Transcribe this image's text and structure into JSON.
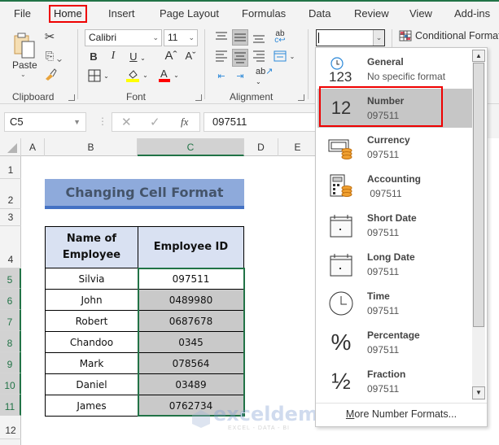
{
  "ribbon_tabs": [
    {
      "label": "File"
    },
    {
      "label": "Home",
      "active": true
    },
    {
      "label": "Insert"
    },
    {
      "label": "Page Layout"
    },
    {
      "label": "Formulas"
    },
    {
      "label": "Data"
    },
    {
      "label": "Review"
    },
    {
      "label": "View"
    },
    {
      "label": "Add-ins"
    }
  ],
  "ribbon": {
    "clipboard": {
      "label": "Clipboard",
      "paste_label": "Paste"
    },
    "font": {
      "label": "Font",
      "font_name": "Calibri",
      "font_size": "11",
      "fill_color": "#ffff00",
      "font_color": "#ff0000"
    },
    "alignment": {
      "label": "Alignment"
    },
    "number_format_value": "",
    "conditional_formatting_label": "Conditional Format"
  },
  "formula_bar": {
    "name_box": "C5",
    "fx_label": "fx",
    "value": "097511"
  },
  "columns": [
    "A",
    "B",
    "C",
    "D",
    "E"
  ],
  "selected_column": "C",
  "rows": [
    "1",
    "2",
    "3",
    "4",
    "5",
    "6",
    "7",
    "8",
    "9",
    "10",
    "11",
    "12"
  ],
  "sheet": {
    "title": "Changing Cell Format",
    "headers": {
      "name": "Name of\nEmployee",
      "id": "Employee ID"
    },
    "records": [
      {
        "name": "Silvia",
        "id": "097511"
      },
      {
        "name": "John",
        "id": "0489980"
      },
      {
        "name": "Robert",
        "id": "0687678"
      },
      {
        "name": "Chandoo",
        "id": "0345"
      },
      {
        "name": "Mark",
        "id": "078564"
      },
      {
        "name": "Daniel",
        "id": "03489"
      },
      {
        "name": "James",
        "id": "0762734"
      }
    ]
  },
  "number_format_dropdown": {
    "items": [
      {
        "name": "General",
        "example": "No specific format",
        "icon": "general-123-icon"
      },
      {
        "name": "Number",
        "example": "097511",
        "icon": "number-12-icon",
        "highlighted": true
      },
      {
        "name": "Currency",
        "example": "097511",
        "icon": "currency-icon"
      },
      {
        "name": "Accounting",
        "example": " 097511",
        "icon": "accounting-icon"
      },
      {
        "name": "Short Date",
        "example": "097511",
        "icon": "calendar-icon"
      },
      {
        "name": "Long Date",
        "example": "097511",
        "icon": "calendar-icon"
      },
      {
        "name": "Time",
        "example": "097511",
        "icon": "clock-icon"
      },
      {
        "name": "Percentage",
        "example": "097511",
        "icon": "percent-icon"
      },
      {
        "name": "Fraction",
        "example": "097511",
        "icon": "fraction-icon"
      }
    ],
    "more_label_underlined": "M",
    "more_label_rest": "ore Number Formats..."
  },
  "watermark": {
    "brand": "exceldemy",
    "tagline": "EXCEL - DATA - BI"
  },
  "colors": {
    "excel_green": "#217346",
    "highlight_red": "#ee0000",
    "title_fill": "#8eaadb",
    "header_fill": "#d9e1f2"
  }
}
